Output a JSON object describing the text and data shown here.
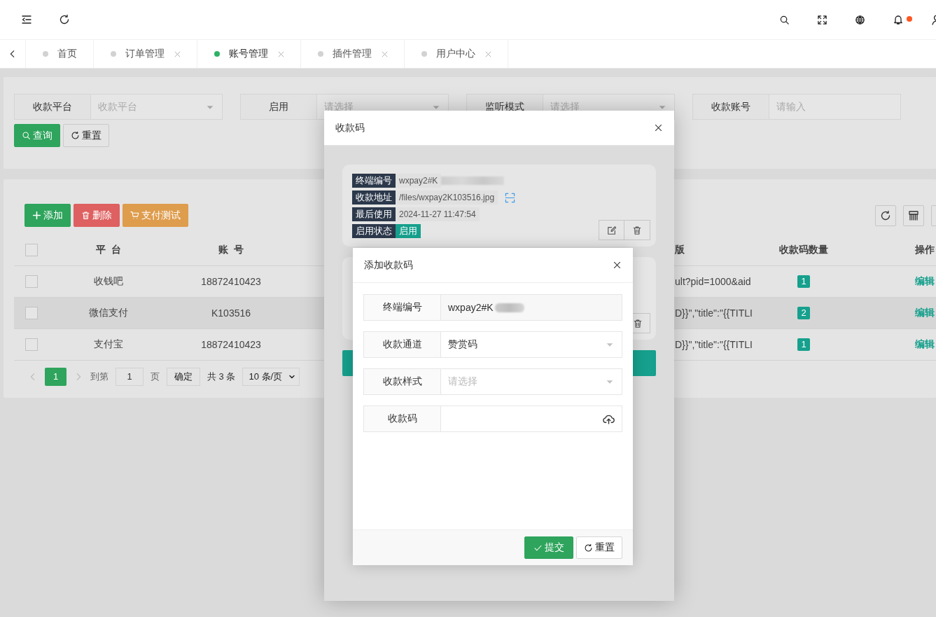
{
  "topbar": {
    "notification": true
  },
  "tabs": [
    {
      "label": "首页",
      "selected": false,
      "closable": false
    },
    {
      "label": "订单管理",
      "selected": false,
      "closable": true
    },
    {
      "label": "账号管理",
      "selected": true,
      "closable": true
    },
    {
      "label": "插件管理",
      "selected": false,
      "closable": true
    },
    {
      "label": "用户中心",
      "selected": false,
      "closable": true
    }
  ],
  "filters": [
    {
      "label": "收款平台",
      "kind": "select",
      "placeholder": "收款平台"
    },
    {
      "label": "启用",
      "kind": "select",
      "placeholder": "请选择"
    },
    {
      "label": "监听模式",
      "kind": "select",
      "placeholder": "请选择"
    },
    {
      "label": "收款账号",
      "kind": "input",
      "placeholder": "请输入"
    }
  ],
  "filter_buttons": [
    {
      "label": "查询",
      "kind": "search"
    },
    {
      "label": "重置",
      "kind": "reset"
    }
  ],
  "toolbar": [
    {
      "label": "添加",
      "kind": "add"
    },
    {
      "label": "删除",
      "kind": "delete"
    },
    {
      "label": "支付测试",
      "kind": "test"
    }
  ],
  "table": {
    "all_checked": false,
    "columns": [
      "平台",
      "账号",
      "版",
      "收款码数量",
      "操作"
    ],
    "rows": [
      {
        "checked": false,
        "hovered": false,
        "platform": "收钱吧",
        "account": "18872410423",
        "column_3": "ult?pid=1000&aid",
        "count": "1",
        "action": "编辑"
      },
      {
        "checked": false,
        "hovered": true,
        "platform": "微信支付",
        "account": "K103516",
        "column_3": "D}}\",\"title\":\"{{TITLI",
        "count": "2",
        "action": "编辑"
      },
      {
        "checked": false,
        "hovered": false,
        "platform": "支付宝",
        "account": "18872410423",
        "column_3": "D}}\",\"title\":\"{{TITLI",
        "count": "1",
        "action": "编辑"
      }
    ]
  },
  "pagination": {
    "current": "1",
    "goto_label": "到第",
    "page_input": "1",
    "page_unit": "页",
    "confirm": "确定",
    "total": "共 3 条",
    "page_size": "10 条/页"
  },
  "qr_dialog": {
    "title": "收款码",
    "cards": [
      {
        "fields": [
          {
            "label": "终端编号",
            "value": "wxpay2#K",
            "kind": "redacted"
          },
          {
            "label": "收款地址",
            "value": "/files/wxpay2K103516.jpg",
            "kind": "link"
          },
          {
            "label": "最后使用",
            "value": "2024-11-27 11:47:54",
            "kind": "text"
          },
          {
            "label": "启用状态",
            "value": "启用",
            "kind": "status"
          }
        ]
      }
    ]
  },
  "add_dialog": {
    "title": "添加收款码",
    "fields": [
      {
        "label": "终端编号",
        "kind": "text",
        "value": "wxpay2#K",
        "redacted": true
      },
      {
        "label": "收款通道",
        "kind": "select",
        "value": "赞赏码"
      },
      {
        "label": "收款样式",
        "kind": "select",
        "placeholder": "请选择"
      },
      {
        "label": "收款码",
        "kind": "upload"
      }
    ],
    "buttons": [
      {
        "label": "提交",
        "kind": "submit"
      },
      {
        "label": "重置",
        "kind": "reset"
      }
    ]
  }
}
